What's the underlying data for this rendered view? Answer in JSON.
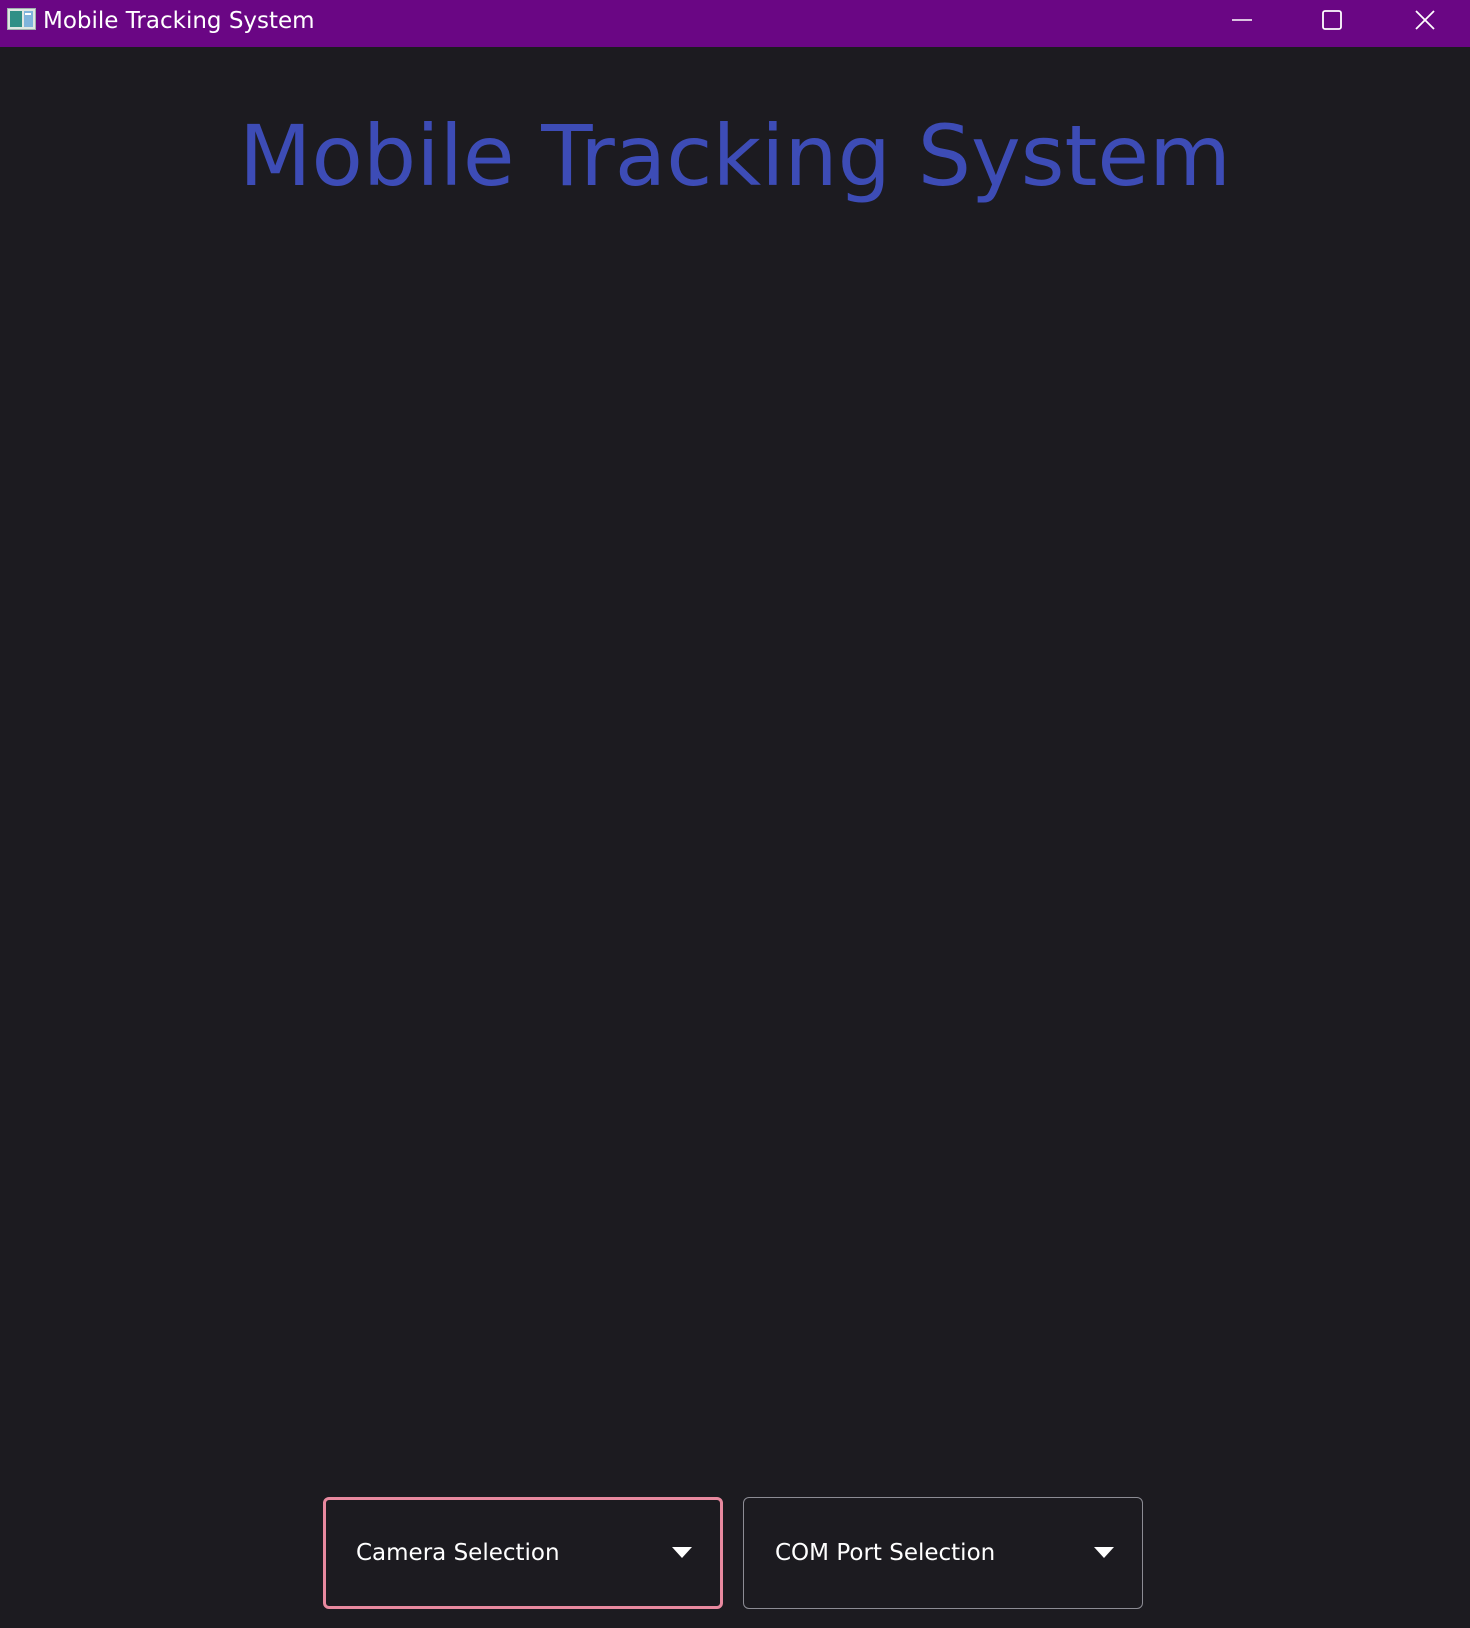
{
  "window": {
    "title": "Mobile Tracking System",
    "titlebar_color": "#6a0684",
    "icon": "app-window-icon",
    "controls": {
      "minimize_icon": "minimize-icon",
      "maximize_icon": "maximize-icon",
      "close_icon": "close-icon"
    }
  },
  "main": {
    "heading": "Mobile Tracking System",
    "heading_color": "#3d4cb6",
    "background_color": "#1c1b20"
  },
  "controls": {
    "camera_select": {
      "label": "Camera Selection",
      "border_color": "#e8899f",
      "icon": "chevron-down-icon"
    },
    "com_port_select": {
      "label": "COM Port Selection",
      "border_color": "#8c8c94",
      "icon": "chevron-down-icon"
    }
  }
}
